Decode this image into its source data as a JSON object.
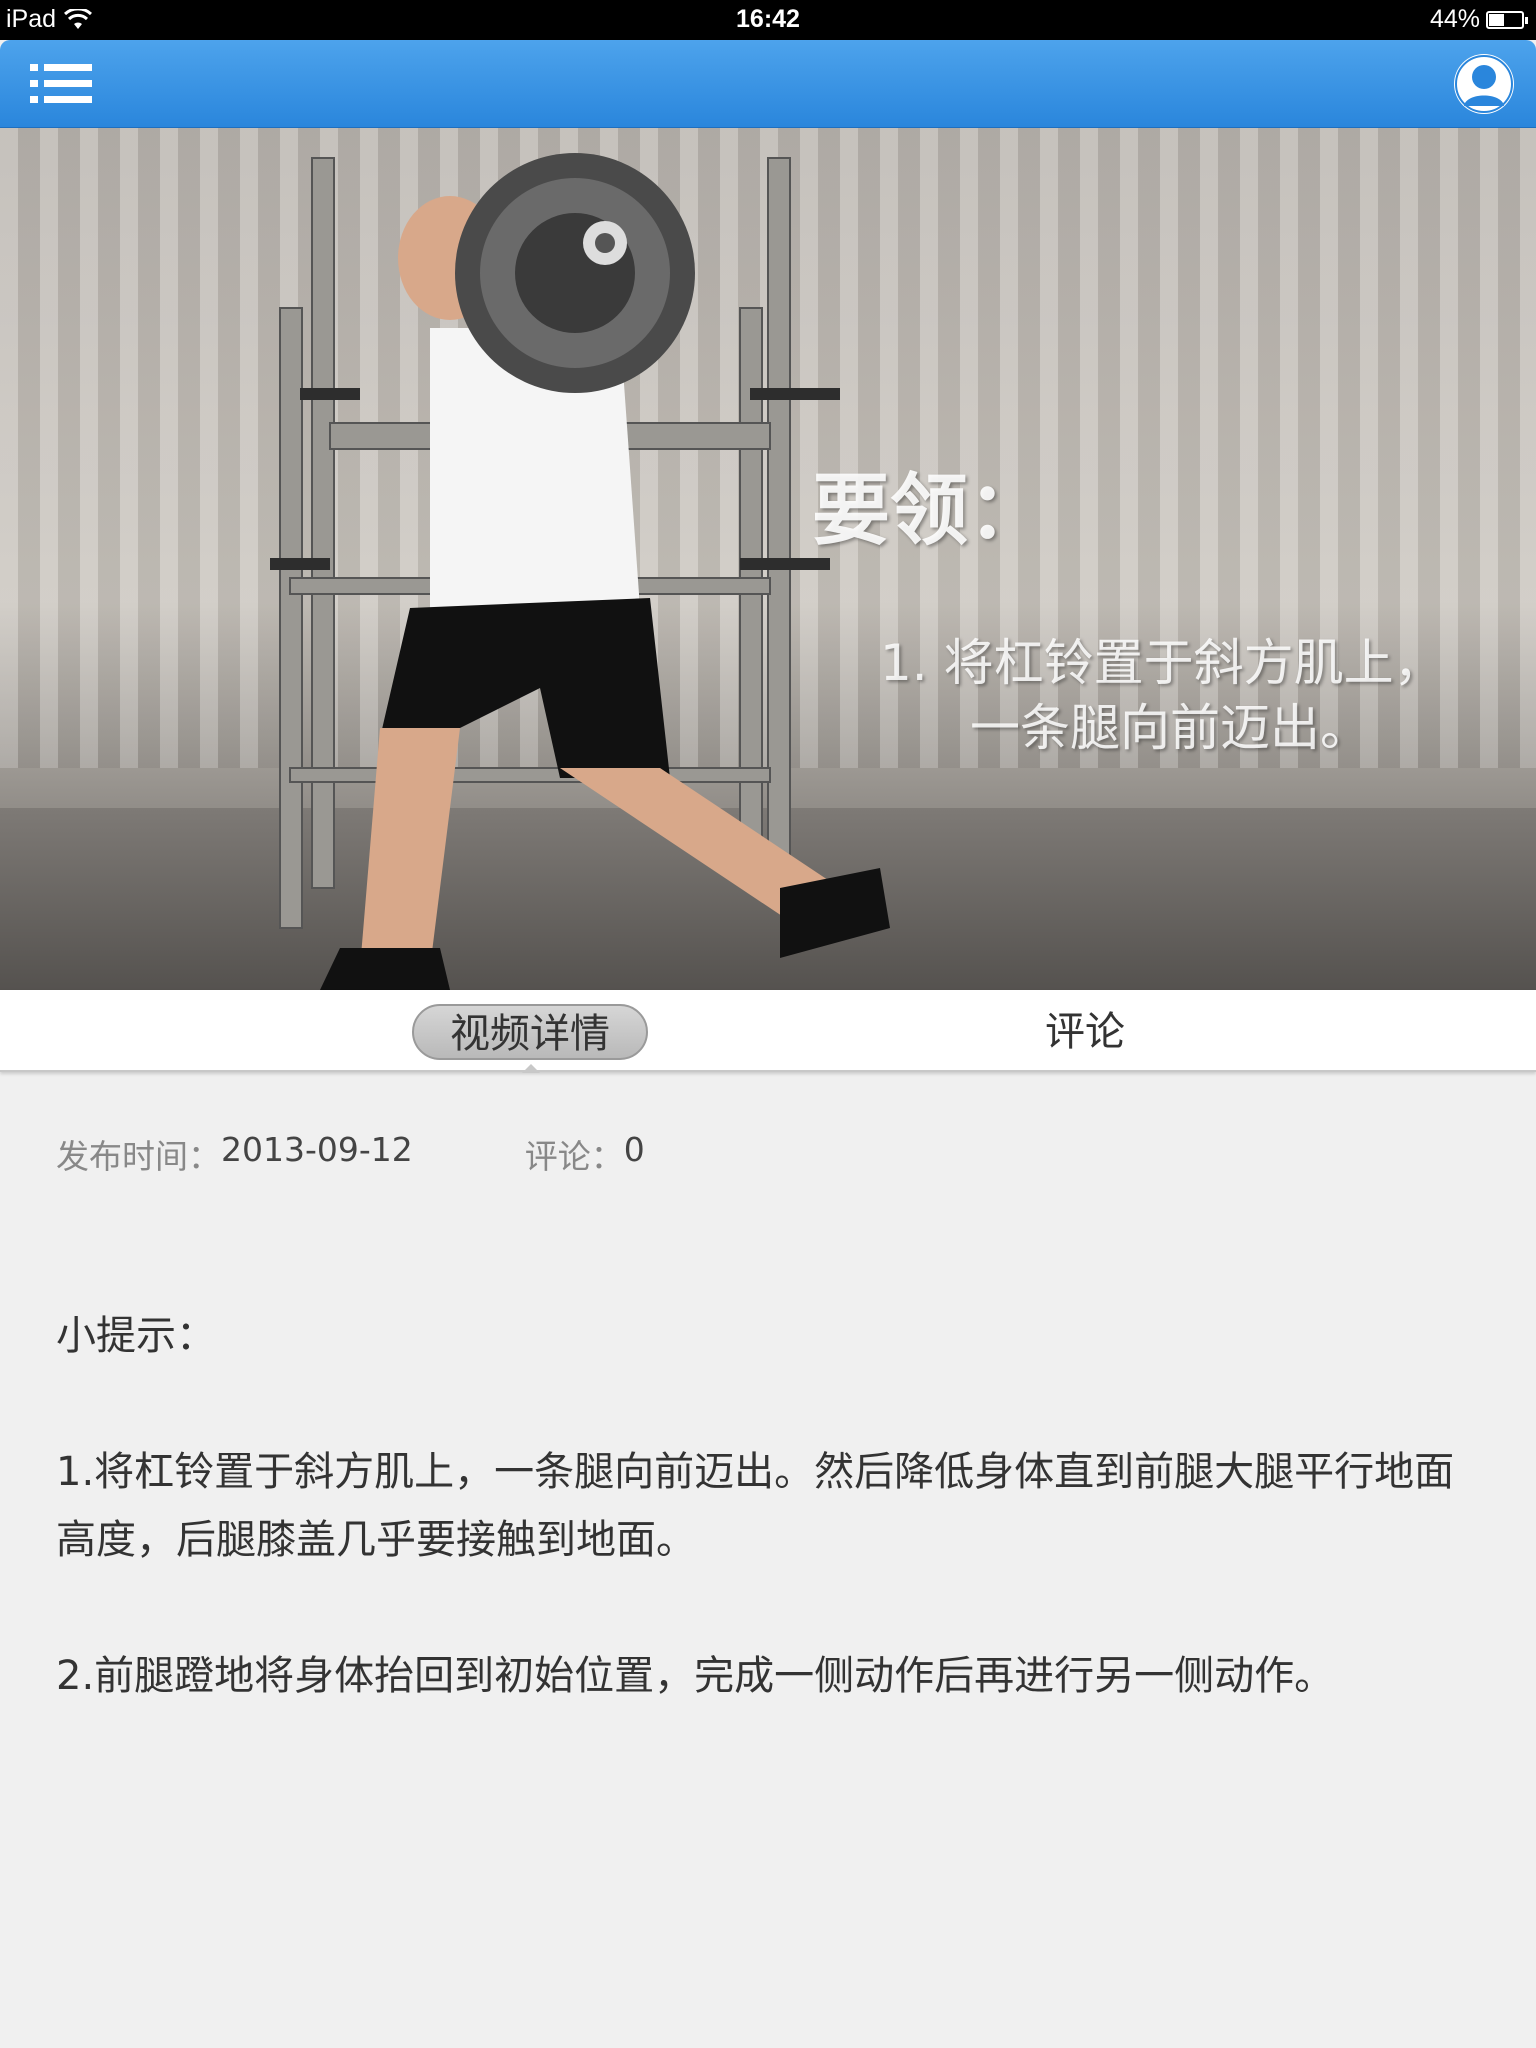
{
  "status_bar": {
    "device": "iPad",
    "time": "16:42",
    "battery": "44%",
    "battery_level": 0.44
  },
  "navbar": {
    "menu_icon": "list-menu-icon",
    "profile_icon": "user-avatar-icon",
    "accent_color": "#3a96e6"
  },
  "video": {
    "overlay_title": "要领：",
    "overlay_line1": "1. 将杠铃置于斜方肌上，",
    "overlay_line2": "一条腿向前迈出。"
  },
  "tabs": [
    {
      "label": "视频详情",
      "active": true
    },
    {
      "label": "评论",
      "active": false
    }
  ],
  "meta": {
    "publish_label": "发布时间：",
    "publish_date": "2013-09-12",
    "comments_label": "评论：",
    "comments_count": "0"
  },
  "tips": {
    "heading": "小提示：",
    "item1": "1.将杠铃置于斜方肌上，一条腿向前迈出。然后降低身体直到前腿大腿平行地面高度，后腿膝盖几乎要接触到地面。",
    "item2": "2.前腿蹬地将身体抬回到初始位置，完成一侧动作后再进行另一侧动作。"
  }
}
